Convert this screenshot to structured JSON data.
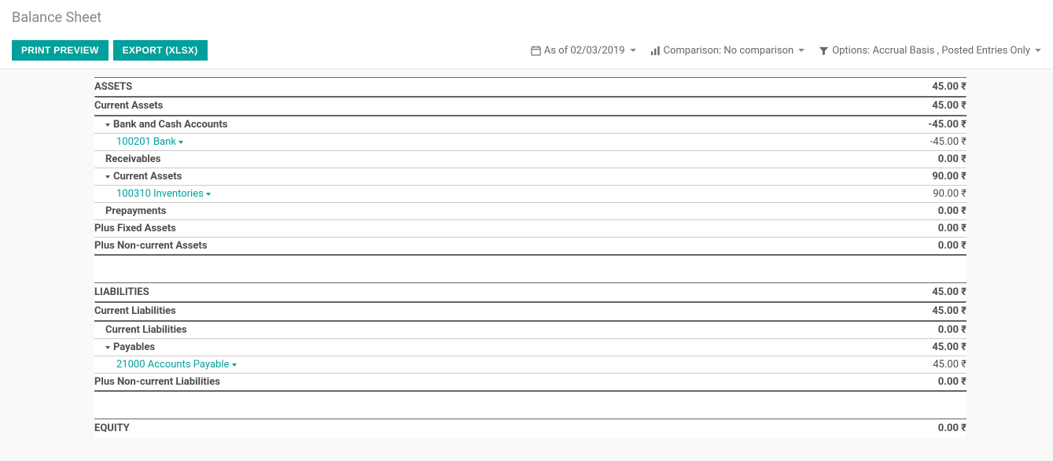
{
  "page": {
    "title": "Balance Sheet"
  },
  "toolbar": {
    "print_label": "PRINT PREVIEW",
    "export_label": "EXPORT (XLSX)"
  },
  "filters": {
    "date_label": "As of 02/03/2019",
    "comparison_label": "Comparison: No comparison",
    "options_label": "Options: Accrual Basis , Posted Entries Only"
  },
  "currency": "₹",
  "sections": {
    "assets": {
      "label": "ASSETS",
      "value": "45.00",
      "current_assets": {
        "label": "Current Assets",
        "value": "45.00"
      },
      "bank_cash": {
        "label": "Bank and Cash Accounts",
        "value": "-45.00"
      },
      "bank_acct": {
        "label": "100201 Bank",
        "value": "-45.00"
      },
      "receivables": {
        "label": "Receivables",
        "value": "0.00"
      },
      "current_assets_sub": {
        "label": "Current Assets",
        "value": "90.00"
      },
      "inventories": {
        "label": "100310 Inventories",
        "value": "90.00"
      },
      "prepayments": {
        "label": "Prepayments",
        "value": "0.00"
      },
      "fixed": {
        "label": "Plus Fixed Assets",
        "value": "0.00"
      },
      "noncurrent": {
        "label": "Plus Non-current Assets",
        "value": "0.00"
      }
    },
    "liabilities": {
      "label": "LIABILITIES",
      "value": "45.00",
      "current": {
        "label": "Current Liabilities",
        "value": "45.00"
      },
      "current_sub": {
        "label": "Current Liabilities",
        "value": "0.00"
      },
      "payables": {
        "label": "Payables",
        "value": "45.00"
      },
      "ap": {
        "label": "21000 Accounts Payable",
        "value": "45.00"
      },
      "noncurrent": {
        "label": "Plus Non-current Liabilities",
        "value": "0.00"
      }
    },
    "equity": {
      "label": "EQUITY",
      "value": "0.00"
    }
  }
}
